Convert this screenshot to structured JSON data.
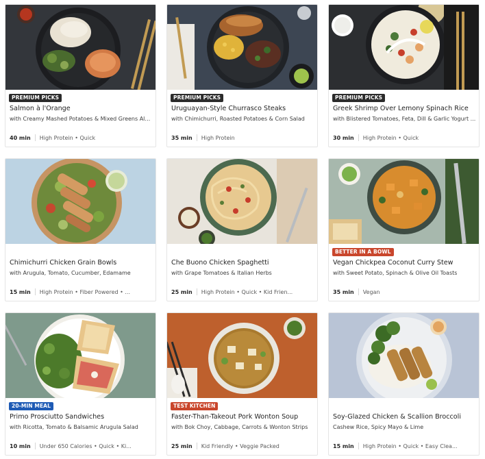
{
  "colors": {
    "premium": "#2b2b2b",
    "better_in_bowl": "#c9462c",
    "twenty_min": "#1f5bb5",
    "test_kitchen": "#c9462c"
  },
  "recipes": [
    {
      "badge": "PREMIUM PICKS",
      "badge_color": "#2b2b2b",
      "title": "Salmon à l'Orange",
      "subtitle": "with Creamy Mashed Potatoes & Mixed Greens Almo...",
      "time": "40 min",
      "tags": "High Protein • Quick"
    },
    {
      "badge": "PREMIUM PICKS",
      "badge_color": "#2b2b2b",
      "title": "Uruguayan-Style Churrasco Steaks",
      "subtitle": "with Chimichurri, Roasted Potatoes & Corn Salad",
      "time": "35 min",
      "tags": "High Protein"
    },
    {
      "badge": "PREMIUM PICKS",
      "badge_color": "#2b2b2b",
      "title": "Greek Shrimp Over Lemony Spinach Rice",
      "subtitle": "with Blistered Tomatoes, Feta, Dill & Garlic Yogurt ...",
      "time": "30 min",
      "tags": "High Protein • Quick"
    },
    {
      "badge": "",
      "badge_color": "",
      "title": "Chimichurri Chicken Grain Bowls",
      "subtitle": "with Arugula, Tomato, Cucumber, Edamame",
      "time": "15 min",
      "tags": "High Protein • Fiber Powered • ..."
    },
    {
      "badge": "",
      "badge_color": "",
      "title": "Che Buono Chicken Spaghetti",
      "subtitle": "with Grape Tomatoes & Italian Herbs",
      "time": "25 min",
      "tags": "High Protein • Quick • Kid Frien..."
    },
    {
      "badge": "BETTER IN A BOWL",
      "badge_color": "#c9462c",
      "title": "Vegan Chickpea Coconut Curry Stew",
      "subtitle": "with Sweet Potato, Spinach & Olive Oil Toasts",
      "time": "35 min",
      "tags": "Vegan"
    },
    {
      "badge": "20-MIN MEAL",
      "badge_color": "#1f5bb5",
      "title": "Primo Prosciutto Sandwiches",
      "subtitle": "with Ricotta, Tomato & Balsamic Arugula Salad",
      "time": "10 min",
      "tags": "Under 650 Calories • Quick • Ki..."
    },
    {
      "badge": "TEST KITCHEN",
      "badge_color": "#c9462c",
      "title": "Faster-Than-Takeout Pork Wonton Soup",
      "subtitle": "with Bok Choy, Cabbage, Carrots & Wonton Strips",
      "time": "25 min",
      "tags": "Kid Friendly • Veggie Packed"
    },
    {
      "badge": "",
      "badge_color": "",
      "title": "Soy-Glazed Chicken & Scallion Broccoli",
      "subtitle": "Cashew Rice, Spicy Mayo & Lime",
      "time": "15 min",
      "tags": "High Protein • Quick • Easy Clea..."
    }
  ]
}
